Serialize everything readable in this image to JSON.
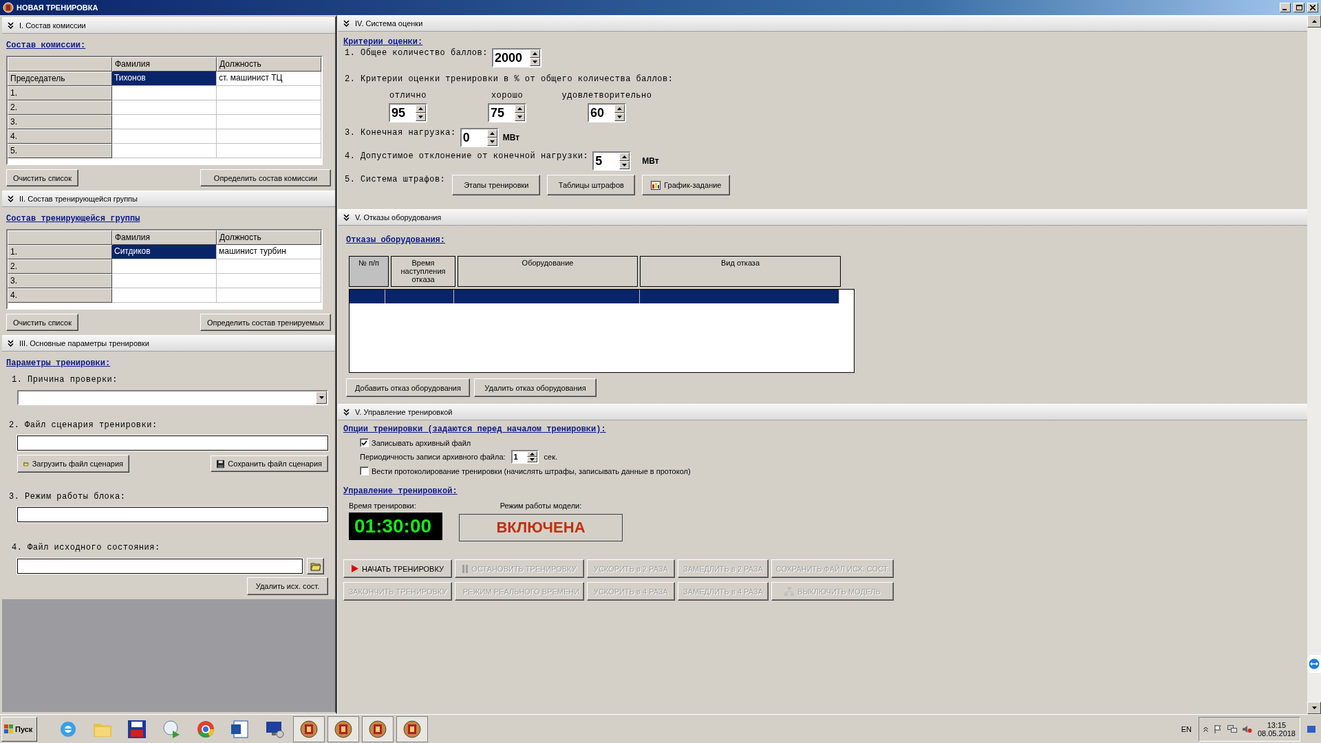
{
  "window": {
    "title": "НОВАЯ ТРЕНИРОВКА"
  },
  "commission": {
    "header": "I. Состав комиссии",
    "heading": "Состав комиссии:",
    "columns": [
      "Фамилия",
      "Должность"
    ],
    "rows": [
      {
        "label": "Председатель",
        "surname": "Тихонов",
        "position": "ст. машинист ТЦ",
        "selected": true
      },
      {
        "label": "1.",
        "selected": false
      },
      {
        "label": "2.",
        "selected": false
      },
      {
        "label": "3.",
        "selected": false
      },
      {
        "label": "4.",
        "selected": false
      },
      {
        "label": "5.",
        "selected": false
      }
    ],
    "buttons": [
      "Очистить список",
      "Определить состав комиссии"
    ]
  },
  "group": {
    "header": "II. Состав тренирующейся группы",
    "heading": "Состав тренирующейся группы",
    "columns": [
      "Фамилия",
      "Должность"
    ],
    "rows": [
      {
        "label": "1.",
        "surname": "Ситдиков",
        "position": "машинист турбин",
        "selected": true
      },
      {
        "label": "2.",
        "selected": false
      },
      {
        "label": "3.",
        "selected": false
      },
      {
        "label": "4.",
        "selected": false
      }
    ],
    "buttons": [
      "Очистить список",
      "Определить состав тренируемых"
    ]
  },
  "params": {
    "header": "III. Основные параметры тренировки",
    "heading": "Параметры тренировки:",
    "reason_label": "1. Причина проверки:",
    "scenario_label": "2. Файл сценария тренировки:",
    "load_button": "Загрузить файл сценария",
    "save_button": "Сохранить файл сценария",
    "mode_label": "3. Режим работы блока:",
    "state_label": "4. Файл исходного состояния:",
    "delete_button": "Удалить исх. сост."
  },
  "evaluation": {
    "header": "IV. Система оценки",
    "heading": "Критерии оценки:",
    "total_label": "1. Общее количество баллов:",
    "total": "2000",
    "criteria_label": "2. Критерии оценки тренировки в % от общего количества баллов:",
    "criteria": [
      {
        "label": "отлично",
        "value": "95"
      },
      {
        "label": "хорошо",
        "value": "75"
      },
      {
        "label": "удовлетворительно",
        "value": "60"
      }
    ],
    "load_label": "3. Конечная нагрузка:",
    "load": "0",
    "load_unit": "МВт",
    "deviation_label": "4. Допустимое отклонение от конечной нагрузки:",
    "deviation": "5",
    "deviation_unit": "МВт",
    "penalty_label": "5. Система штрафов:",
    "penalty_buttons": [
      {
        "label": "Этапы тренировки",
        "kind": "plain"
      },
      {
        "label": "Таблицы штрафов",
        "kind": "plain"
      },
      {
        "label": "График-задание",
        "kind": "chart"
      }
    ]
  },
  "failures": {
    "header": "V. Отказы оборудования",
    "heading": "Отказы оборудования:",
    "columns": [
      "№ п/п",
      "Время наступления отказа",
      "Оборудование",
      "Вид отказа"
    ],
    "rows": [
      {
        "selected": true
      }
    ],
    "buttons": [
      "Добавить отказ оборудования",
      "Удалить отказ оборудования"
    ]
  },
  "control": {
    "header": "V. Управление тренировкой",
    "options_heading": "Опции тренировки (задаются перед началом тренировки):",
    "options": [
      {
        "kind": "checkbox",
        "label": "Записывать архивный файл",
        "checked": true
      },
      {
        "kind": "spin",
        "label": "Периодичность записи архивного файла:",
        "value": "1",
        "unit": "сек."
      },
      {
        "kind": "checkbox",
        "label": "Вести протоколирование тренировки (начислять штрафы, записывать данные в протокол)",
        "checked": false
      }
    ],
    "control_heading": "Управление тренировкой:",
    "time_label": "Время тренировки:",
    "time": "01:30:00",
    "mode_label": "Режим работы модели:",
    "mode": "ВКЛЮЧЕНА",
    "actions": [
      {
        "label": "НАЧАТЬ ТРЕНИРОВКУ",
        "disabled": false
      },
      {
        "label": "ОСТАНОВИТЬ ТРЕНИРОВКУ",
        "disabled": true
      },
      {
        "label": "УСКОРИТЬ в 2 РАЗА",
        "disabled": true
      },
      {
        "label": "ЗАМЕДЛИТЬ в 2 РАЗА",
        "disabled": true
      },
      {
        "label": "СОХРАНИТЬ ФАЙЛ ИСХ. СОСТ.",
        "disabled": true
      },
      {
        "label": "ЗАКОНЧИТЬ ТРЕНИРОВКУ",
        "disabled": true
      },
      {
        "label": "РЕЖИМ РЕАЛЬНОГО ВРЕМЕНИ",
        "disabled": true
      },
      {
        "label": "УСКОРИТЬ в 4 РАЗА",
        "disabled": true
      },
      {
        "label": "ЗАМЕДЛИТЬ в 4 РАЗА",
        "disabled": true
      },
      {
        "label": "ВЫКЛЮЧИТЬ МОДЕЛЬ",
        "disabled": true
      }
    ]
  },
  "taskbar": {
    "start": "Пуск",
    "language": "EN",
    "time": "13:15",
    "date": "08.05.2018"
  }
}
